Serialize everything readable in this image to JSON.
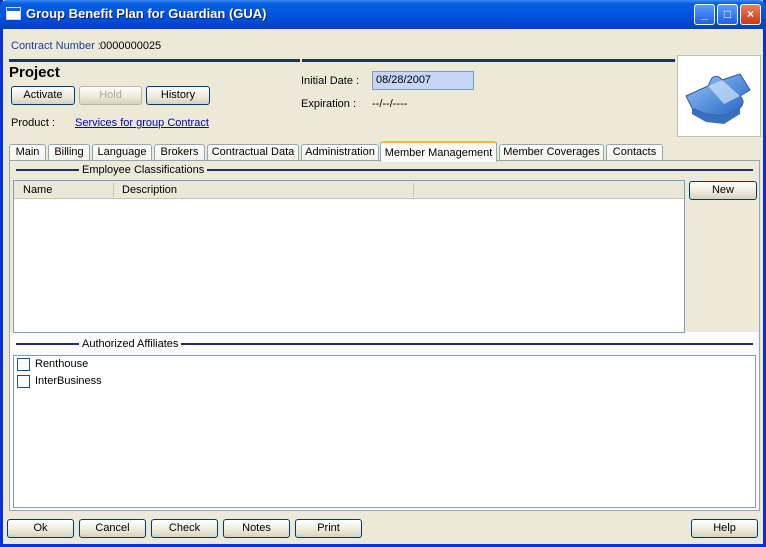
{
  "window": {
    "title": "Group Benefit Plan for Guardian (GUA)",
    "controls": {
      "minimize": "_",
      "maximize": "□",
      "close": "×"
    }
  },
  "contract": {
    "label": "Contract Number :",
    "value": "0000000025"
  },
  "project": {
    "title": "Project",
    "buttons": {
      "activate": "Activate",
      "hold": "Hold",
      "history": "History"
    },
    "product_label": "Product :",
    "product_link": "Services for group Contract"
  },
  "dates": {
    "initial_label": "Initial Date :",
    "initial_value": "08/28/2007",
    "expiration_label": "Expiration :",
    "expiration_value": "--/--/----"
  },
  "logo": {
    "icon": "puzzle-icon"
  },
  "tabs": [
    "Main",
    "Billing",
    "Language",
    "Brokers",
    "Contractual Data",
    "Administration",
    "Member Management",
    "Member Coverages",
    "Contacts"
  ],
  "active_tab": "Member Management",
  "employee_classifications": {
    "title": "Employee Classifications",
    "columns": [
      "Name",
      "Description"
    ],
    "rows": [],
    "new_button": "New"
  },
  "authorized_affiliates": {
    "title": "Authorized Affiliates",
    "items": [
      {
        "label": "Renthouse",
        "checked": false
      },
      {
        "label": "InterBusiness",
        "checked": false
      }
    ]
  },
  "footer": {
    "ok": "Ok",
    "cancel": "Cancel",
    "check": "Check",
    "notes": "Notes",
    "print": "Print",
    "help": "Help"
  },
  "colors": {
    "title_bar": "#0054e3",
    "accent_rule": "#1c2d78",
    "date_field_bg": "#c6d6f6",
    "active_tab_highlight": "#f8b83c"
  }
}
